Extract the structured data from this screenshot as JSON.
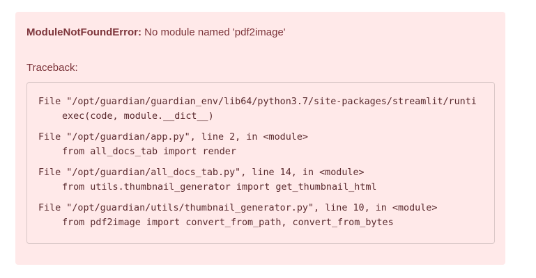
{
  "error": {
    "type": "ModuleNotFoundError:",
    "message": " No module named 'pdf2image'",
    "traceback_label": "Traceback:",
    "frames": [
      {
        "location": "File \"/opt/guardian/guardian_env/lib64/python3.7/site-packages/streamlit/runti",
        "code": "exec(code, module.__dict__)"
      },
      {
        "location": "File \"/opt/guardian/app.py\", line 2, in <module>",
        "code": "from all_docs_tab import render"
      },
      {
        "location": "File \"/opt/guardian/all_docs_tab.py\", line 14, in <module>",
        "code": "from utils.thumbnail_generator import get_thumbnail_html"
      },
      {
        "location": "File \"/opt/guardian/utils/thumbnail_generator.py\", line 10, in <module>",
        "code": "from pdf2image import convert_from_path, convert_from_bytes"
      }
    ]
  }
}
